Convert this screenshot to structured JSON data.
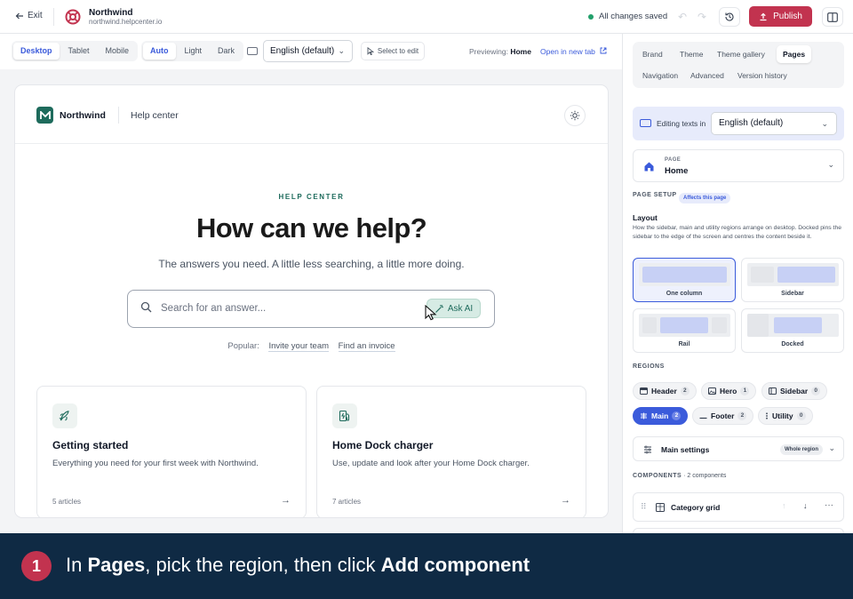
{
  "topbar": {
    "exit_label": "Exit",
    "brand_name": "Northwind",
    "brand_url": "northwind.helpcenter.io",
    "save_status": "All changes saved",
    "publish_label": "Publish"
  },
  "toolbar": {
    "devices": [
      "Desktop",
      "Tablet",
      "Mobile"
    ],
    "active_device": "Desktop",
    "themes": [
      "Auto",
      "Light",
      "Dark"
    ],
    "active_theme": "Auto",
    "language": "English (default)",
    "select_to_edit": "Select to edit",
    "previewing_label": "Previewing:",
    "previewing_page": "Home",
    "open_new_tab": "Open in new tab"
  },
  "preview": {
    "site_name": "Northwind",
    "help_center": "Help center",
    "eyebrow": "HELP CENTER",
    "title": "How can we help?",
    "subtitle": "The answers you need. A little less searching, a little more doing.",
    "search_placeholder": "Search for an answer...",
    "ask_ai": "Ask AI",
    "popular_label": "Popular:",
    "popular_links": [
      "Invite your team",
      "Find an invoice"
    ],
    "cards": [
      {
        "title": "Getting started",
        "description": "Everything you need for your first week with Northwind.",
        "count": "5 articles",
        "icon": "rocket-icon"
      },
      {
        "title": "Home Dock charger",
        "description": "Use, update and look after your Home Dock charger.",
        "count": "7 articles",
        "icon": "ev-charger-icon"
      }
    ]
  },
  "panel": {
    "tabs_row1": [
      "Brand",
      "Theme",
      "Theme gallery",
      "Pages"
    ],
    "tabs_row2": [
      "Navigation",
      "Advanced",
      "Version history"
    ],
    "active_tab": "Pages",
    "editing_texts_label": "Editing texts in",
    "editing_language": "English (default)",
    "page_label": "PAGE",
    "page_name": "Home",
    "page_setup_label": "PAGE SETUP",
    "affects_badge": "Affects this page",
    "layout_title": "Layout",
    "layout_description": "How the sidebar, main and utility regions arrange on desktop. Docked pins the sidebar to the edge of the screen and centres the content beside it.",
    "layout_options": [
      "One column",
      "Sidebar",
      "Rail",
      "Docked"
    ],
    "active_layout": "One column",
    "regions_label": "REGIONS",
    "regions": [
      {
        "name": "Header",
        "count": "2"
      },
      {
        "name": "Hero",
        "count": "1"
      },
      {
        "name": "Sidebar",
        "count": "0"
      },
      {
        "name": "Main",
        "count": "2"
      },
      {
        "name": "Footer",
        "count": "2"
      },
      {
        "name": "Utility",
        "count": "0"
      }
    ],
    "active_region": "Main",
    "main_settings_label": "Main settings",
    "whole_region_badge": "Whole region",
    "components_label": "COMPONENTS",
    "components_count": "· 2 components",
    "components": [
      "Category grid"
    ]
  },
  "banner": {
    "step": "1",
    "text_1": "In ",
    "bold_1": "Pages",
    "text_2": ", pick the region, then click ",
    "bold_2": "Add component"
  },
  "colors": {
    "accent": "#3b5bdb",
    "publish": "#c2334f",
    "brand_green": "#1e6b5c",
    "banner_bg": "#0f2a44"
  }
}
